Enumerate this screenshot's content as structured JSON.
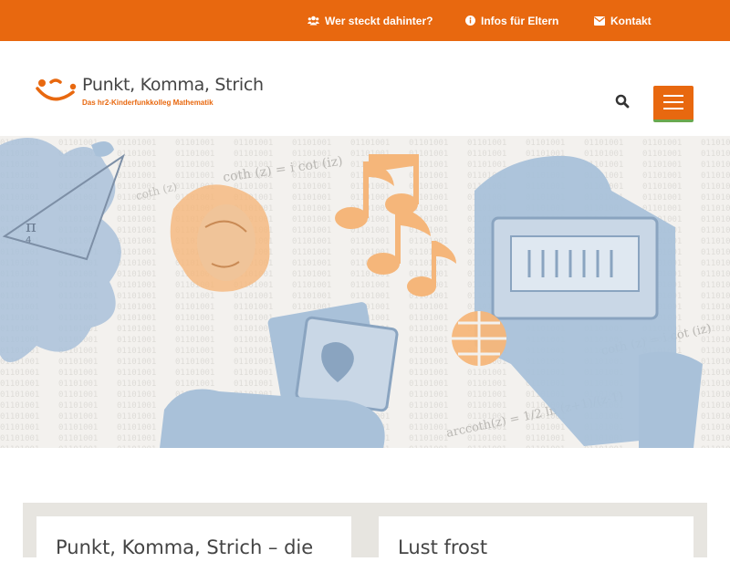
{
  "topbar": {
    "links": [
      {
        "label": "Wer steckt dahinter?",
        "icon": "users-icon"
      },
      {
        "label": "Infos für Eltern",
        "icon": "info-circle-icon"
      },
      {
        "label": "Kontakt",
        "icon": "envelope-icon"
      }
    ]
  },
  "header": {
    "logo_title": "Punkt, Komma, Strich",
    "logo_subtitle": "Das hr2-Kinderfunkkolleg Mathematik",
    "search_icon": "search-icon",
    "menu_icon": "hamburger-menu-icon"
  },
  "hero": {
    "formula_1": "coth (z) = i cot (iz)",
    "formula_2": "arccoth(z) = 1/2 ln (z+1)/(z-1)",
    "formula_3": "coth (z) = i cot (iz)",
    "formula_4": "coth (z)"
  },
  "cards": [
    {
      "title": "Punkt, Komma, Strich – die"
    },
    {
      "title": "Lust frost"
    }
  ],
  "colors": {
    "accent": "#e8680f",
    "menu_underline": "#6aa84f",
    "hero_blue": "#a9c1d9",
    "hero_orange": "#f5b67a",
    "panel_bg": "#e7e5e0"
  }
}
